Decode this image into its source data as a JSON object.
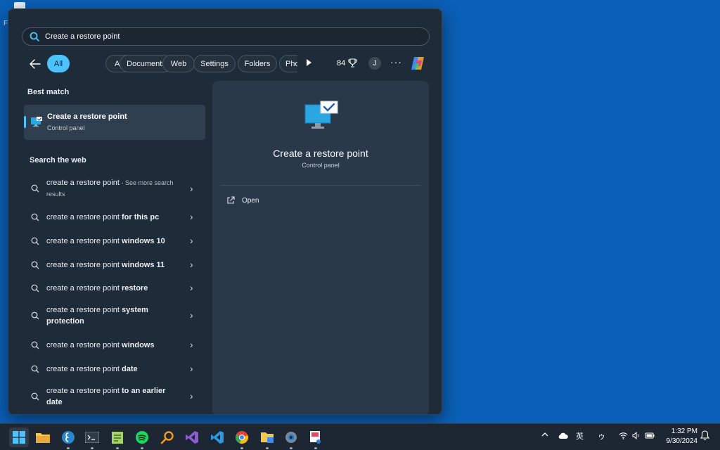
{
  "desktop": {
    "letter": "F"
  },
  "search": {
    "value": "Create a restore point",
    "icon": "search-icon"
  },
  "filters": {
    "items": [
      "All",
      "Apps",
      "Documents",
      "Web",
      "Settings",
      "Folders",
      "Pho"
    ],
    "active": "All",
    "points": "84",
    "avatar": "J"
  },
  "best_match": {
    "heading": "Best match",
    "title": "Create a restore point",
    "subtitle": "Control panel"
  },
  "web": {
    "heading": "Search the web",
    "items": [
      {
        "plain": "create a restore point",
        "bold": "",
        "sub": " - See more search results"
      },
      {
        "plain": "create a restore point ",
        "bold": "for this pc",
        "sub": ""
      },
      {
        "plain": "create a restore point ",
        "bold": "windows 10",
        "sub": ""
      },
      {
        "plain": "create a restore point ",
        "bold": "windows 11",
        "sub": ""
      },
      {
        "plain": "create a restore point ",
        "bold": "restore",
        "sub": ""
      },
      {
        "plain": "create a restore point ",
        "bold": "system protection",
        "sub": ""
      },
      {
        "plain": "create a restore point ",
        "bold": "windows",
        "sub": ""
      },
      {
        "plain": "create a restore point ",
        "bold": "date",
        "sub": ""
      },
      {
        "plain": "create a restore point ",
        "bold": "to an earlier date",
        "sub": ""
      }
    ]
  },
  "detail": {
    "title": "Create a restore point",
    "subtitle": "Control panel",
    "actions": [
      {
        "label": "Open",
        "icon": "open-external-icon"
      }
    ]
  },
  "taskbar": {
    "apps": [
      "start",
      "file-explorer",
      "edge-dev",
      "terminal",
      "notepad",
      "spotify",
      "search-tool",
      "visual-studio",
      "vscode",
      "chrome",
      "file-manager",
      "settings",
      "snipping-tool"
    ],
    "tray": {
      "ime": "英",
      "ime2": "ゥ"
    },
    "time": "1:32 PM",
    "date": "9/30/2024"
  }
}
